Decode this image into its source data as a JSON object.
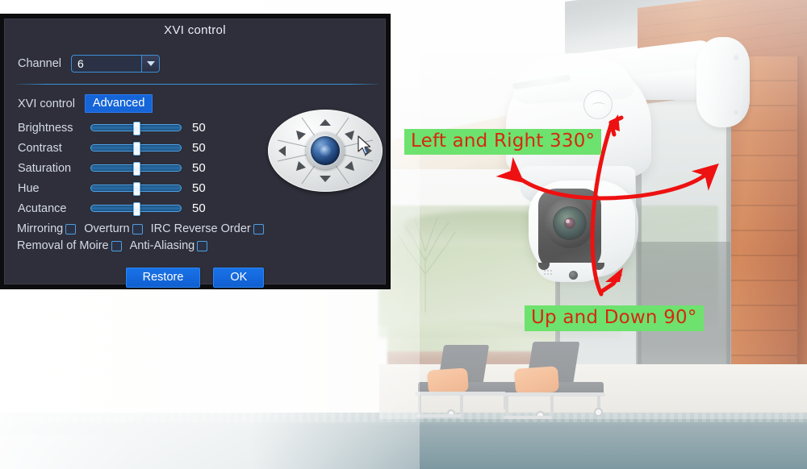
{
  "dialog": {
    "title": "XVI control",
    "channel_label": "Channel",
    "channel_value": "6",
    "mode_label": "XVI control",
    "mode_value": "Advanced",
    "sliders": [
      {
        "name": "Brightness",
        "value": "50",
        "percent": 50
      },
      {
        "name": "Contrast",
        "value": "50",
        "percent": 50
      },
      {
        "name": "Saturation",
        "value": "50",
        "percent": 50
      },
      {
        "name": "Hue",
        "value": "50",
        "percent": 50
      },
      {
        "name": "Acutance",
        "value": "50",
        "percent": 50
      }
    ],
    "checkboxes_row1": [
      {
        "label": "Mirroring",
        "checked": false
      },
      {
        "label": "Overturn",
        "checked": false
      },
      {
        "label": "IRC Reverse Order",
        "checked": false
      }
    ],
    "checkboxes_row2": [
      {
        "label": "Removal of Moire",
        "checked": false
      },
      {
        "label": "Anti-Aliasing",
        "checked": false
      }
    ],
    "buttons": [
      {
        "label": "Restore"
      },
      {
        "label": "OK"
      }
    ],
    "colors": {
      "panel_bg": "#2e2f3a",
      "accent_blue": "#1565d8",
      "border_blue": "#3d8fd6",
      "text": "#d5dbe6"
    }
  },
  "ptz": {
    "name": "ptz-joystick",
    "directions": [
      "up",
      "up-right",
      "right",
      "down-right",
      "down",
      "down-left",
      "left",
      "up-left"
    ],
    "center_icon": "lens-icon",
    "cursor_icon": "mouse-cursor"
  },
  "annotations": {
    "pan_label": "Left and Right 330°",
    "tilt_label": "Up and Down 90°",
    "highlight_color": "#6ee26e",
    "text_color": "#d42a10",
    "arrow_color": "#ee1111"
  },
  "photo": {
    "description": "Outdoor white PTZ dome security camera mounted on wall bracket above a poolside patio",
    "elements": [
      "camera-dome",
      "wall-mount-bracket",
      "camera-lens",
      "roof-overhang",
      "glass-sliding-door",
      "wood-siding-wall",
      "lounge-chair",
      "lounge-chair",
      "swimming-pool"
    ],
    "colors": {
      "wood": "#bb5c2a",
      "pool": "#8fa6ad",
      "cushion": "#f0a978",
      "chair": "#72767a",
      "grass": "#bccfa6"
    }
  }
}
